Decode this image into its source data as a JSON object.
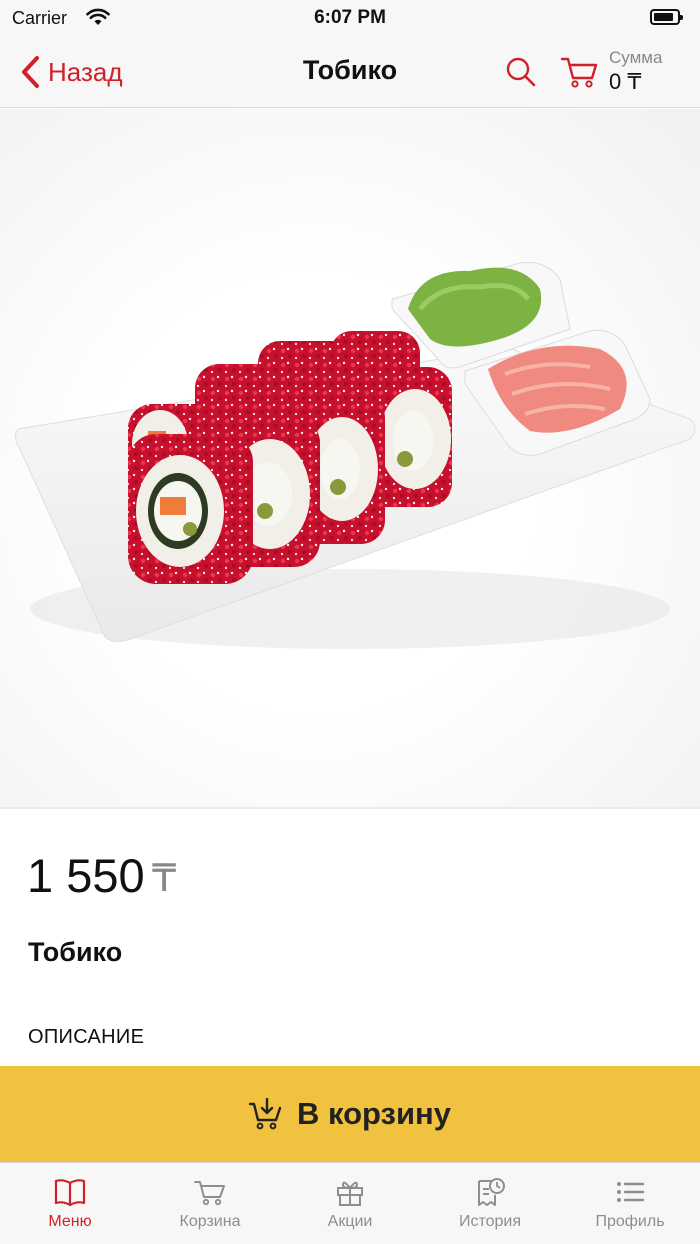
{
  "status_bar": {
    "carrier": "Carrier",
    "time": "6:07 PM",
    "battery_level": 0.85
  },
  "nav": {
    "back_label": "Назад",
    "title": "Тобико",
    "sum_label": "Сумма",
    "sum_value": "0 ₸",
    "icons": [
      "chevron-left-icon",
      "search-icon",
      "cart-icon"
    ]
  },
  "colors": {
    "accent": "#d0202a",
    "button": "#f1c23f",
    "tab_inactive": "#8e8e8e"
  },
  "product": {
    "price": "1 550",
    "currency": "₸",
    "name": "Тобико",
    "description_heading": "ОПИСАНИЕ"
  },
  "add_to_cart": {
    "label": "В корзину",
    "icon": "cart-download-icon"
  },
  "tab_bar": {
    "items": [
      {
        "label": "Меню",
        "icon": "book-icon",
        "active": true
      },
      {
        "label": "Корзина",
        "icon": "cart-icon",
        "active": false
      },
      {
        "label": "Акции",
        "icon": "gift-icon",
        "active": false
      },
      {
        "label": "История",
        "icon": "receipt-clock-icon",
        "active": false
      },
      {
        "label": "Профиль",
        "icon": "list-icon",
        "active": false
      }
    ]
  }
}
